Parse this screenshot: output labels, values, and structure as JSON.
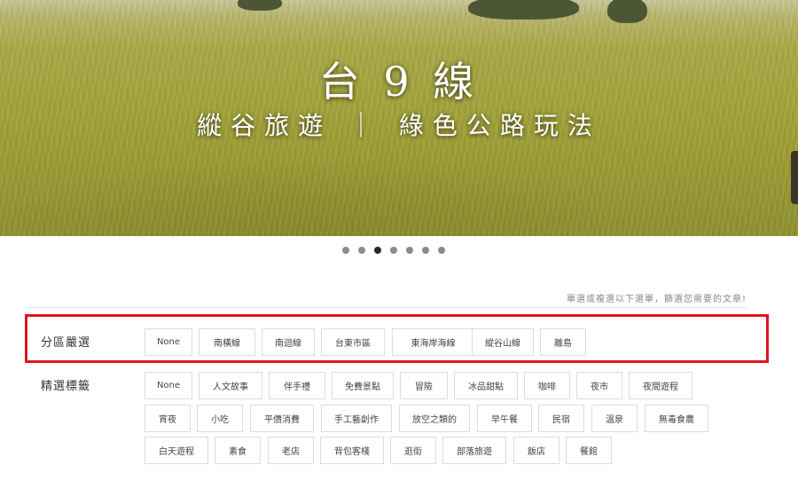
{
  "hero": {
    "title": "台 9 線",
    "subtitle": "縱谷旅遊 ｜ 綠色公路玩法"
  },
  "carousel": {
    "slide_count": 7,
    "active_index": 2
  },
  "filters": {
    "hint": "單選或複選以下選單，篩選您需要的文章!",
    "region": {
      "label": "分區嚴選",
      "tags": [
        "None",
        "南橫線",
        "南迴線",
        "台東市區",
        "東海岸海線",
        "縱谷山線",
        "離島"
      ]
    },
    "featured": {
      "label": "精選標籤",
      "tags": [
        "None",
        "人文故事",
        "伴手禮",
        "免費景點",
        "冒險",
        "冰品甜點",
        "咖啡",
        "夜市",
        "夜間遊程",
        "宵夜",
        "小吃",
        "平價消費",
        "手工藝創作",
        "放空之類的",
        "早午餐",
        "民宿",
        "溫泉",
        "無毒食農",
        "白天遊程",
        "素食",
        "老店",
        "背包客棧",
        "逛街",
        "部落旅遊",
        "飯店",
        "餐館"
      ]
    }
  }
}
